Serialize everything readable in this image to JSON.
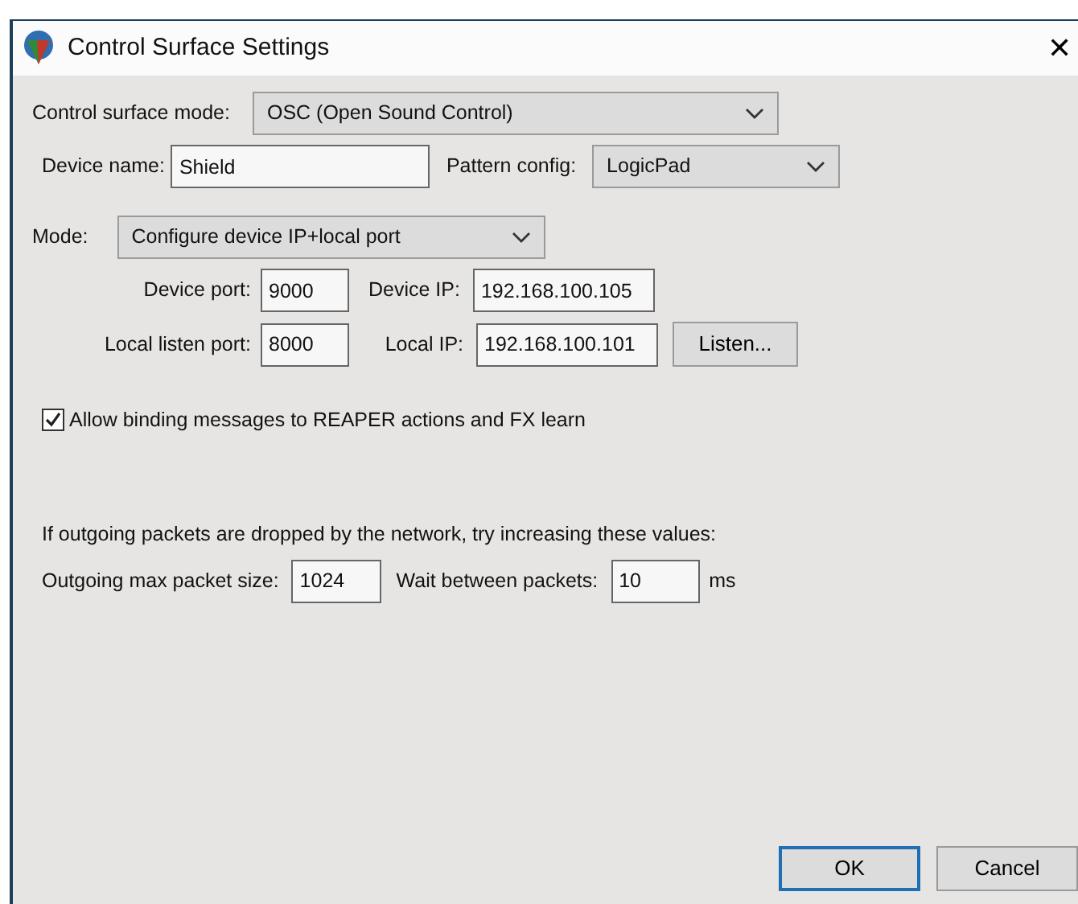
{
  "window": {
    "title": "Control Surface Settings",
    "close": "✕"
  },
  "control_surface_mode": {
    "label": "Control surface mode:",
    "value": "OSC (Open Sound Control)"
  },
  "device_name": {
    "label": "Device name:",
    "value": "Shield"
  },
  "pattern_config": {
    "label": "Pattern config:",
    "value": "LogicPad"
  },
  "mode": {
    "label": "Mode:",
    "value": "Configure device IP+local port"
  },
  "device_port": {
    "label": "Device port:",
    "value": "9000"
  },
  "device_ip": {
    "label": "Device IP:",
    "value": "192.168.100.105"
  },
  "local_listen_port": {
    "label": "Local listen port:",
    "value": "8000"
  },
  "local_ip": {
    "label": "Local IP:",
    "value": "192.168.100.101"
  },
  "listen_button": "Listen...",
  "allow_binding": {
    "label": "Allow binding messages to REAPER actions and FX learn",
    "checked": true
  },
  "packets_hint": "If outgoing packets are dropped by the network, try increasing these values:",
  "max_packet_size": {
    "label": "Outgoing max packet size:",
    "value": "1024"
  },
  "wait_between": {
    "label": "Wait between packets:",
    "value": "10",
    "unit": "ms"
  },
  "buttons": [
    {
      "label": "OK",
      "default": true
    },
    {
      "label": "Cancel",
      "default": false
    }
  ]
}
